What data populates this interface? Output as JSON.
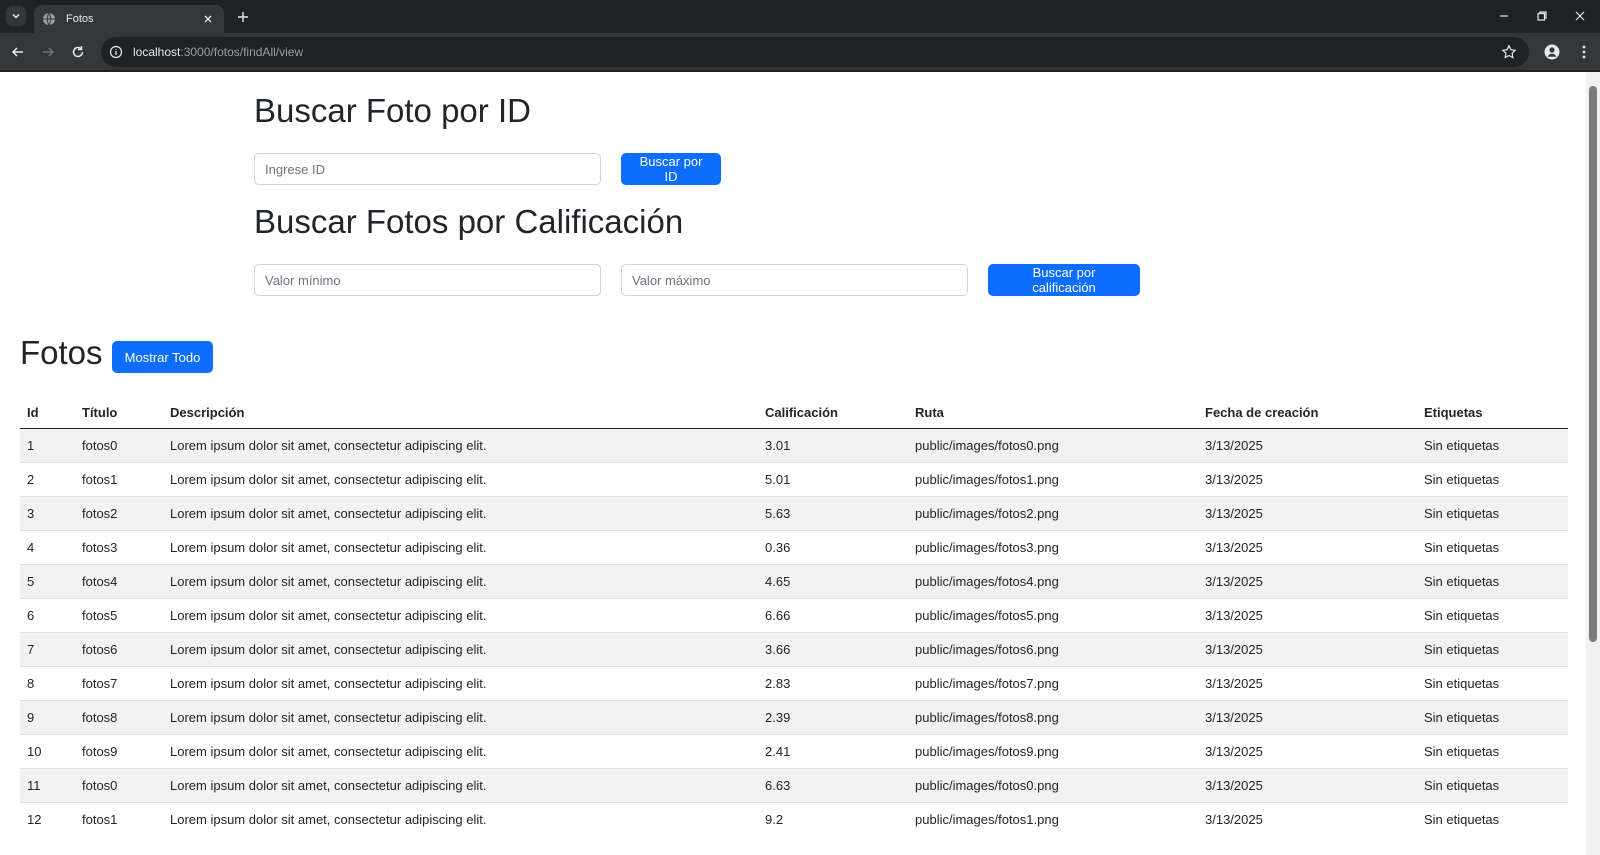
{
  "browser": {
    "tab_title": "Fotos",
    "url_host": "localhost",
    "url_path": ":3000/fotos/findAll/view"
  },
  "search_id": {
    "heading": "Buscar Foto por ID",
    "placeholder": "Ingrese ID",
    "button": "Buscar por ID"
  },
  "search_rating": {
    "heading": "Buscar Fotos por Calificación",
    "min_placeholder": "Valor mínimo",
    "max_placeholder": "Valor máximo",
    "button": "Buscar por calificación"
  },
  "fotos": {
    "heading": "Fotos",
    "show_all_button": "Mostrar Todo",
    "columns": [
      "Id",
      "Título",
      "Descripción",
      "Calificación",
      "Ruta",
      "Fecha de creación",
      "Etiquetas"
    ],
    "rows": [
      [
        "1",
        "fotos0",
        "Lorem ipsum dolor sit amet, consectetur adipiscing elit.",
        "3.01",
        "public/images/fotos0.png",
        "3/13/2025",
        "Sin etiquetas"
      ],
      [
        "2",
        "fotos1",
        "Lorem ipsum dolor sit amet, consectetur adipiscing elit.",
        "5.01",
        "public/images/fotos1.png",
        "3/13/2025",
        "Sin etiquetas"
      ],
      [
        "3",
        "fotos2",
        "Lorem ipsum dolor sit amet, consectetur adipiscing elit.",
        "5.63",
        "public/images/fotos2.png",
        "3/13/2025",
        "Sin etiquetas"
      ],
      [
        "4",
        "fotos3",
        "Lorem ipsum dolor sit amet, consectetur adipiscing elit.",
        "0.36",
        "public/images/fotos3.png",
        "3/13/2025",
        "Sin etiquetas"
      ],
      [
        "5",
        "fotos4",
        "Lorem ipsum dolor sit amet, consectetur adipiscing elit.",
        "4.65",
        "public/images/fotos4.png",
        "3/13/2025",
        "Sin etiquetas"
      ],
      [
        "6",
        "fotos5",
        "Lorem ipsum dolor sit amet, consectetur adipiscing elit.",
        "6.66",
        "public/images/fotos5.png",
        "3/13/2025",
        "Sin etiquetas"
      ],
      [
        "7",
        "fotos6",
        "Lorem ipsum dolor sit amet, consectetur adipiscing elit.",
        "3.66",
        "public/images/fotos6.png",
        "3/13/2025",
        "Sin etiquetas"
      ],
      [
        "8",
        "fotos7",
        "Lorem ipsum dolor sit amet, consectetur adipiscing elit.",
        "2.83",
        "public/images/fotos7.png",
        "3/13/2025",
        "Sin etiquetas"
      ],
      [
        "9",
        "fotos8",
        "Lorem ipsum dolor sit amet, consectetur adipiscing elit.",
        "2.39",
        "public/images/fotos8.png",
        "3/13/2025",
        "Sin etiquetas"
      ],
      [
        "10",
        "fotos9",
        "Lorem ipsum dolor sit amet, consectetur adipiscing elit.",
        "2.41",
        "public/images/fotos9.png",
        "3/13/2025",
        "Sin etiquetas"
      ],
      [
        "11",
        "fotos0",
        "Lorem ipsum dolor sit amet, consectetur adipiscing elit.",
        "6.63",
        "public/images/fotos0.png",
        "3/13/2025",
        "Sin etiquetas"
      ],
      [
        "12",
        "fotos1",
        "Lorem ipsum dolor sit amet, consectetur adipiscing elit.",
        "9.2",
        "public/images/fotos1.png",
        "3/13/2025",
        "Sin etiquetas"
      ]
    ]
  },
  "colors": {
    "primary": "#0d6efd",
    "chrome_dark": "#202124",
    "chrome_toolbar": "#35363a"
  }
}
